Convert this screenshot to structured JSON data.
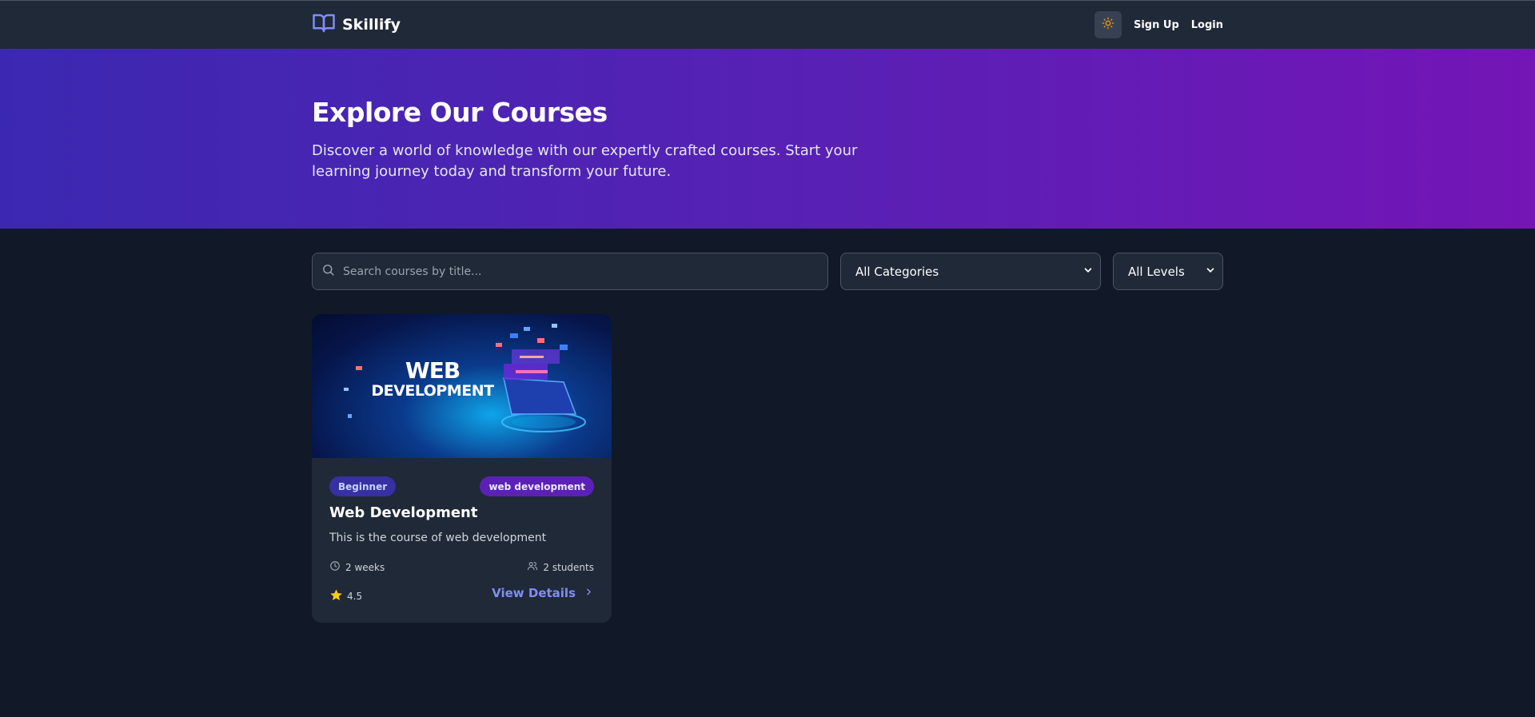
{
  "header": {
    "brand": "Skillify",
    "signup_label": "Sign Up",
    "login_label": "Login",
    "theme_icon": "sun-icon"
  },
  "hero": {
    "title": "Explore Our Courses",
    "subtitle": "Discover a world of knowledge with our expertly crafted courses. Start your learning journey today and transform your future."
  },
  "filters": {
    "search_placeholder": "Search courses by title...",
    "category_selected": "All Categories",
    "level_selected": "All Levels"
  },
  "courses": [
    {
      "image_line1": "WEB",
      "image_line2": "DEVELOPMENT",
      "level": "Beginner",
      "category": "web development",
      "title": "Web Development",
      "description": "This is the course of web development",
      "duration": "2 weeks",
      "students": "2 students",
      "rating": "4.5",
      "details_label": "View Details"
    }
  ],
  "colors": {
    "page_bg": "#111827",
    "panel_bg": "#1f2937",
    "accent": "#818cf8",
    "hero_start": "#3b28b2",
    "hero_end": "#7415b6",
    "star": "#facc15"
  }
}
